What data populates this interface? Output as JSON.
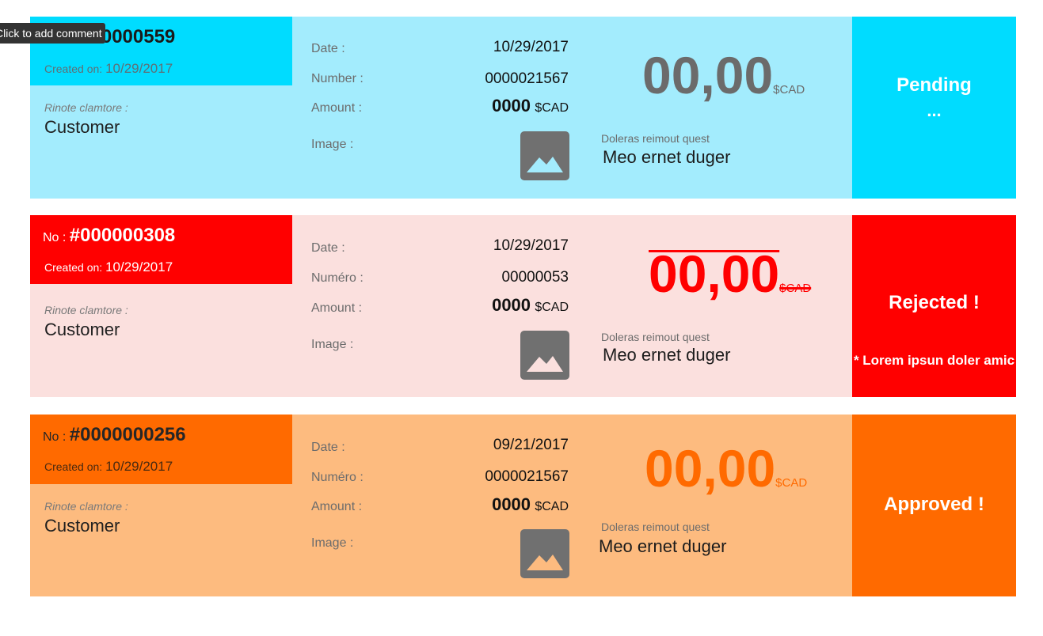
{
  "tooltip": "Click to add comment",
  "cards": [
    {
      "no_label": "No : ",
      "no_value": "#000000559",
      "created_label": "Created on: ",
      "created_value": "10/29/2017",
      "rinote_label": "Rinote clamtore :",
      "customer": "Customer",
      "date_label": "Date  :",
      "date_value": "10/29/2017",
      "number_label": "Number :",
      "number_value": "0000021567",
      "amount_label": "Amount :",
      "amount_value": "0000",
      "amount_currency": "$CAD",
      "image_label": "Image :",
      "big_value": "00,00",
      "big_currency": "$CAD",
      "dq_label": "Doleras reimout quest",
      "dq_value": "Meo ernet duger",
      "status": "Pending",
      "status_sub": "...",
      "colors": {
        "header": "#00dcff",
        "body": "#a3ecfd",
        "status": "#00dcff",
        "big": "#6b6b6b"
      }
    },
    {
      "no_label": "No : ",
      "no_value": "#000000308",
      "created_label": "Created on: ",
      "created_value": "10/29/2017",
      "rinote_label": "Rinote clamtore :",
      "customer": "Customer",
      "date_label": "Date  :",
      "date_value": "10/29/2017",
      "number_label": "Numéro :",
      "number_value": "00000053",
      "amount_label": "Amount :",
      "amount_value": "0000",
      "amount_currency": "$CAD",
      "image_label": "Image :",
      "big_value": "00,00",
      "big_currency": "$CAD",
      "dq_label": "Doleras reimout quest",
      "dq_value": "Meo ernet duger",
      "status": "Rejected !",
      "status_sub": "* Lorem ipsun doler amic",
      "colors": {
        "header": "#ff0000",
        "body": "#fbe0de",
        "status": "#ff0000",
        "big": "#ff0000"
      }
    },
    {
      "no_label": "No : ",
      "no_value": "#0000000256",
      "created_label": "Created on: ",
      "created_value": "10/29/2017",
      "rinote_label": "Rinote clamtore :",
      "customer": "Customer",
      "date_label": "Date  :",
      "date_value": "09/21/2017",
      "number_label": "Numéro :",
      "number_value": "0000021567",
      "amount_label": "Amount :",
      "amount_value": "0000",
      "amount_currency": "$CAD",
      "image_label": "Image :",
      "big_value": "00,00",
      "big_currency": "$CAD",
      "dq_label": "Doleras reimout quest",
      "dq_value": "Meo ernet duger",
      "status": "Approved !",
      "status_sub": "",
      "colors": {
        "header": "#ff6a00",
        "body": "#fdbb7f",
        "status": "#ff6a00",
        "big": "#ff6a00"
      }
    }
  ]
}
